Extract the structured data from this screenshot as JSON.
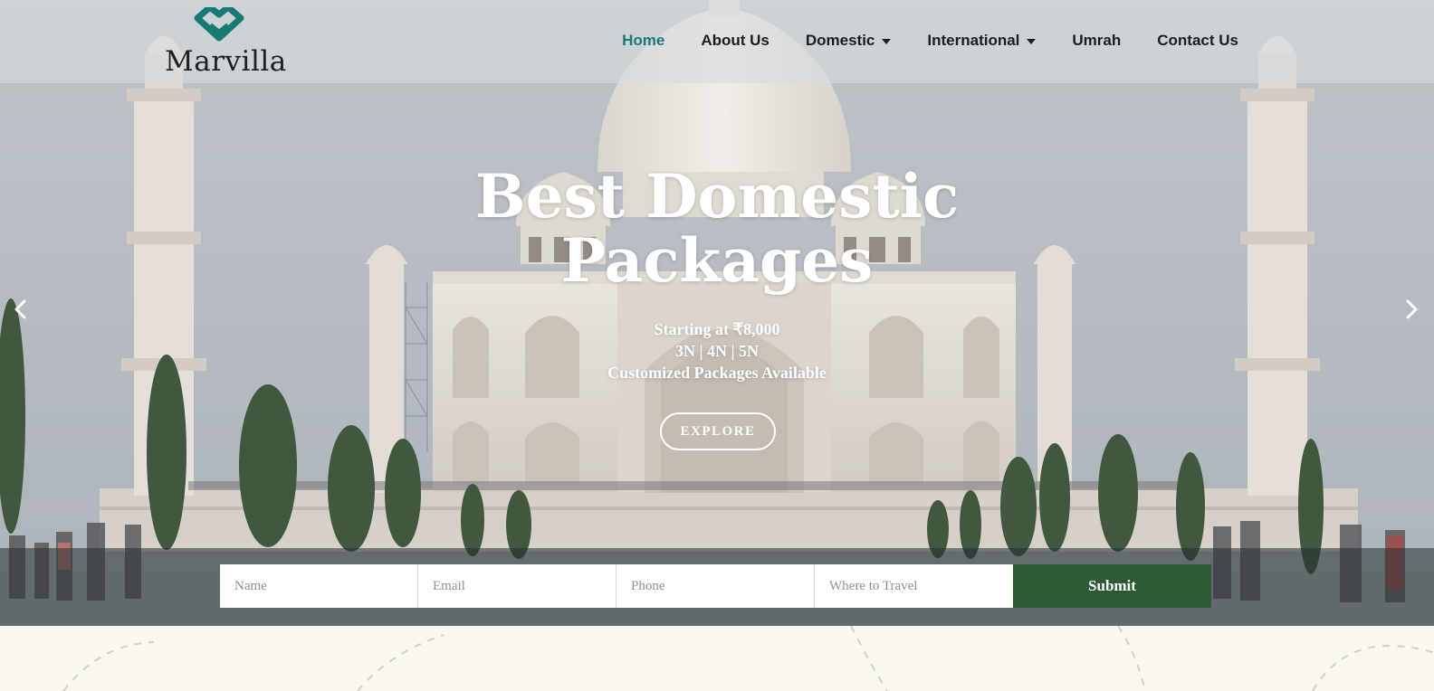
{
  "brand": {
    "name": "Marvilla",
    "accent": "#177a73",
    "logo_mark": "double-chevron-heart-icon"
  },
  "nav": {
    "items": [
      {
        "label": "Home",
        "active": true,
        "dropdown": false
      },
      {
        "label": "About Us",
        "active": false,
        "dropdown": false
      },
      {
        "label": "Domestic",
        "active": false,
        "dropdown": true
      },
      {
        "label": "International",
        "active": false,
        "dropdown": true
      },
      {
        "label": "Umrah",
        "active": false,
        "dropdown": false
      },
      {
        "label": "Contact Us",
        "active": false,
        "dropdown": false
      }
    ]
  },
  "hero": {
    "title_line1": "Best Domestic",
    "title_line2": "Packages",
    "subtitle_lines": [
      "Starting at ₹8,000",
      "3N | 4N | 5N",
      "Customized Packages Available"
    ],
    "cta_label": "EXPLORE",
    "prev_icon": "chevron-left-icon",
    "next_icon": "chevron-right-icon"
  },
  "form": {
    "name_placeholder": "Name",
    "email_placeholder": "Email",
    "phone_placeholder": "Phone",
    "destination_placeholder": "Where to Travel",
    "submit_label": "Submit",
    "submit_color": "#2e5a36"
  }
}
